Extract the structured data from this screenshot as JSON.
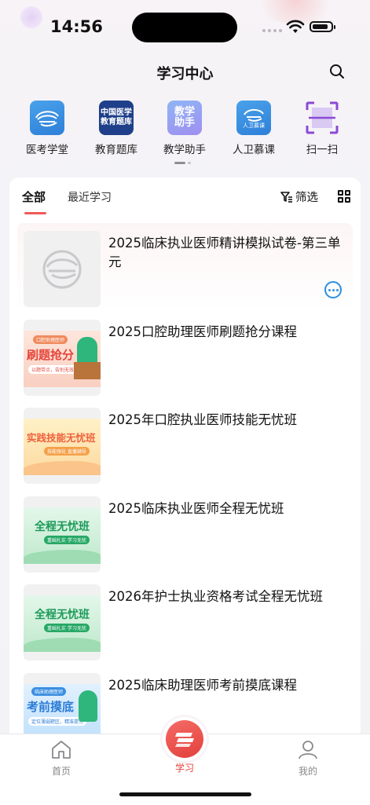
{
  "status": {
    "time": "14:56"
  },
  "header": {
    "title": "学习中心"
  },
  "quick_links": [
    {
      "label": "医考学堂",
      "icon": "yikao-logo-icon"
    },
    {
      "label": "教育题库",
      "icon": "question-bank-icon",
      "icon_text_1": "中国医学",
      "icon_text_2": "教育题库"
    },
    {
      "label": "教学助手",
      "icon": "teaching-assistant-icon",
      "icon_text_1": "教学",
      "icon_text_2": "助手"
    },
    {
      "label": "人卫慕课",
      "icon": "mooc-icon",
      "icon_text": "人卫慕课"
    },
    {
      "label": "扫一扫",
      "icon": "scan-icon"
    }
  ],
  "tabs": {
    "all": "全部",
    "recent": "最近学习"
  },
  "toolbar": {
    "filter": "筛选"
  },
  "courses": [
    {
      "title": "2025临床执业医师精讲模拟试卷-第三单元"
    },
    {
      "title": "2025口腔助理医师刷题抢分课程",
      "thumb_tag": "口腔助理医师",
      "thumb_main": "刷题抢分",
      "thumb_sub": "以题带点，告别无效刷题"
    },
    {
      "title": "2025年口腔执业医师技能无忧班",
      "thumb_main": "实践技能无忧班",
      "thumb_sub": "技能强化 直播辅导"
    },
    {
      "title": "2025临床执业医师全程无忧班",
      "thumb_main": "全程无忧班",
      "thumb_sub": "重础扎实 学习无忧"
    },
    {
      "title": "2026年护士执业资格考试全程无忧班",
      "thumb_main": "全程无忧班",
      "thumb_sub": "重础扎实 学习无忧"
    },
    {
      "title": "2025临床助理医师考前摸底课程",
      "thumb_tag": "临床助理医师",
      "thumb_main": "考前摸底",
      "thumb_sub": "定位薄弱靶区，精准提分"
    }
  ],
  "bottom_nav": [
    {
      "label": "首页"
    },
    {
      "label": "学习"
    },
    {
      "label": "我的"
    }
  ],
  "colors": {
    "accent": "#ef5a55",
    "link_blue": "#2b8fe0",
    "nav_inactive": "#888888"
  }
}
